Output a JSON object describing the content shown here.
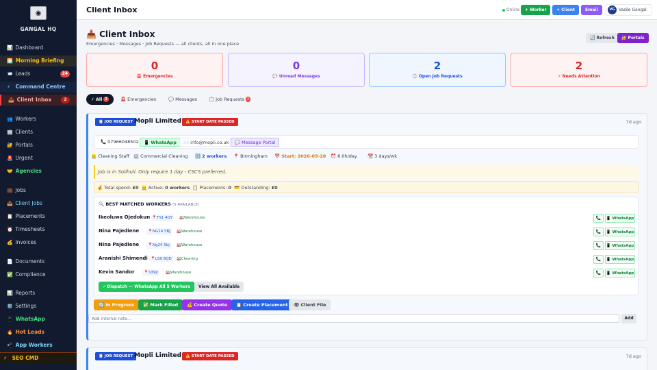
{
  "sidebar": {
    "brand": "GANGAL HQ",
    "items": [
      {
        "icon": "📊",
        "label": "Dashboard"
      },
      {
        "icon": "🌅",
        "label": "Morning Briefing"
      },
      {
        "icon": "📨",
        "label": "Leads",
        "badge": "24"
      },
      {
        "icon": "⚡",
        "label": "Command Centre"
      },
      {
        "icon": "📥",
        "label": "Client Inbox",
        "badge": "2"
      },
      {
        "icon": "👥",
        "label": "Workers"
      },
      {
        "icon": "🏢",
        "label": "Clients"
      },
      {
        "icon": "🔐",
        "label": "Portals"
      },
      {
        "icon": "🚨",
        "label": "Urgent"
      },
      {
        "icon": "🤝",
        "label": "Agencies"
      },
      {
        "icon": "💼",
        "label": "Jobs"
      },
      {
        "icon": "📥",
        "label": "Client Jobs"
      },
      {
        "icon": "📋",
        "label": "Placements"
      },
      {
        "icon": "⏰",
        "label": "Timesheets"
      },
      {
        "icon": "💰",
        "label": "Invoices"
      },
      {
        "icon": "📄",
        "label": "Documents"
      },
      {
        "icon": "✅",
        "label": "Compliance"
      },
      {
        "icon": "📊",
        "label": "Reports"
      },
      {
        "icon": "⚙️",
        "label": "Settings"
      },
      {
        "icon": "📱",
        "label": "WhatsApp"
      },
      {
        "icon": "🔥",
        "label": "Hot Leads"
      },
      {
        "icon": "📲",
        "label": "App Workers"
      },
      {
        "icon": "⚡",
        "label": "SEO CMD"
      }
    ]
  },
  "topbar": {
    "title": "Client Inbox",
    "status": "Online",
    "btn_worker": "+ Worker",
    "btn_client": "+ Client",
    "btn_email": "Email",
    "avatar": "VG",
    "user": "Vasile Gangal"
  },
  "page": {
    "title": "📥 Client Inbox",
    "subtitle": "Emergencies · Messages · Job Requests — all clients, all in one place",
    "refresh": "🔄 Refresh",
    "portals": "🔐 Portals"
  },
  "stats": [
    {
      "value": "0",
      "label": "🚨 Emergencies"
    },
    {
      "value": "0",
      "label": "💬 Unread Messages"
    },
    {
      "value": "2",
      "label": "📋 Open Job Requests"
    },
    {
      "value": "2",
      "label": "⚡ Needs Attention"
    }
  ],
  "tabs": [
    {
      "label": "⚡ All",
      "badge": "2"
    },
    {
      "label": "🚨 Emergencies"
    },
    {
      "label": "💬 Messages"
    },
    {
      "label": "📋 Job Requests",
      "badge": "2"
    }
  ],
  "cards": [
    {
      "type": "📋 JOB REQUEST",
      "name": "Mopli Limited",
      "warning": "⚠️ START DATE PASSED",
      "age": "7d ago",
      "phone": "📞 07966048502",
      "whatsapp": "📱 WhatsApp",
      "email": "✉️ info@mopli.co.uk",
      "portal": "💬 Message Portal",
      "role": "👷 Cleaning Staff",
      "sector": "🏢 Commercial Cleaning",
      "workers_icon": "🔢",
      "workers": "2 workers",
      "location": "📍 Birmingham",
      "start": "📅 Start: 2026-05-28",
      "hours": "⏰ 8.0h/day",
      "days": "📆 3 days/wk",
      "note": "Job is in Solihull. Only require 1 day - CSCS preferred.",
      "spend": {
        "l1": "💰 Total spend:",
        "v1": "£0",
        "l2": "👷 Active:",
        "v2": "0 workers",
        "l3": "📋 Placements:",
        "v3": "0",
        "l4": "💳 Outstanding:",
        "v4": "£0"
      },
      "matches_title": "🔍 BEST MATCHED WORKERS",
      "matches_count": "(5 AVAILABLE)",
      "matches": [
        {
          "name": "Ikeoluwa Ojedokun",
          "postcode": "📍TS1 4QY",
          "tag": "🏭Warehouse"
        },
        {
          "name": "Nina Pajediene",
          "postcode": "📍NG24 5BJ",
          "tag": "🏭Warehouse"
        },
        {
          "name": "Nina Pajediene",
          "postcode": "📍Ng24 5bj",
          "tag": "🏭Warehouse"
        },
        {
          "name": "Aranishi Shimendi",
          "postcode": "📍LS9 8QD",
          "tag": "🏭Cleaning"
        },
        {
          "name": "Kevin Sandor",
          "postcode": "📍S39jt",
          "tag": "🏭Warehouse"
        }
      ],
      "call_icon": "📞",
      "wa_label": "📱 WhatsApp",
      "dispatch": "⚡ Dispatch — WhatsApp All 5 Workers",
      "view_all": "View All Available",
      "actions": [
        "🔄 In Progress",
        "✅ Mark Filled",
        "💰 Create Quote",
        "📋 Create Placement",
        "👁 Client File"
      ],
      "note_placeholder": "Add internal note...",
      "add": "Add"
    },
    {
      "type": "📋 JOB REQUEST",
      "name": "Mopli Limited",
      "warning": "⚠️ START DATE PASSED",
      "age": "7d ago"
    }
  ]
}
